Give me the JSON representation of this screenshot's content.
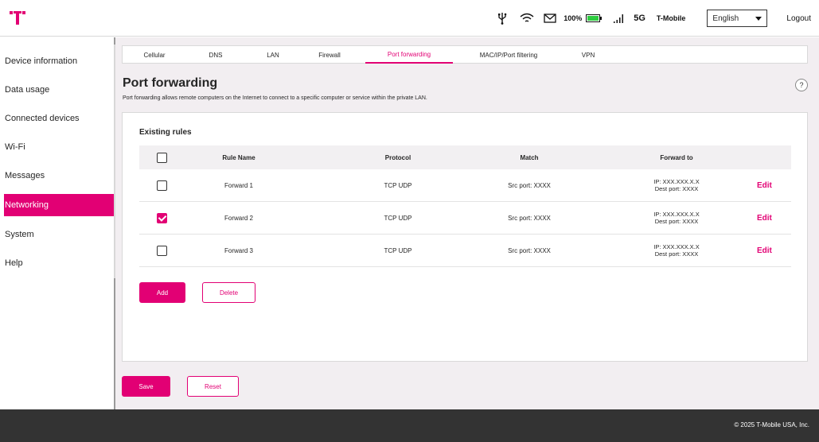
{
  "header": {
    "battery_percent": "100%",
    "network_type": "5G",
    "carrier": "T-Mobile",
    "language": "English",
    "logout_label": "Logout",
    "icons": [
      "t-mobile-logo",
      "usb-icon",
      "wifi-icon",
      "mail-icon",
      "battery-icon",
      "signal-icon",
      "chevron-down-icon"
    ]
  },
  "sidebar": {
    "items": [
      {
        "label": "Device information"
      },
      {
        "label": "Data usage"
      },
      {
        "label": "Connected devices"
      },
      {
        "label": "Wi-Fi"
      },
      {
        "label": "Messages"
      },
      {
        "label": "Networking",
        "active": true
      },
      {
        "label": "System"
      },
      {
        "label": "Help"
      }
    ]
  },
  "tabs": [
    {
      "label": "Cellular"
    },
    {
      "label": "DNS"
    },
    {
      "label": "LAN"
    },
    {
      "label": "Firewall"
    },
    {
      "label": "Port forwarding",
      "active": true
    },
    {
      "label": "MAC/IP/Port filtering"
    },
    {
      "label": "VPN"
    }
  ],
  "page": {
    "title": "Port forwarding",
    "description": "Port forwarding allows remote computers on the Internet to connect to a specific computer or service within the private LAN.",
    "help_label": "?"
  },
  "rules": {
    "title": "Existing rules",
    "headers": {
      "name": "Rule Name",
      "protocol": "Protocol",
      "match": "Match",
      "forward": "Forward to"
    },
    "rows": [
      {
        "name": "Forward 1",
        "protocol": "TCP UDP",
        "match": "Src port: XXXX",
        "ip": "IP: XXX.XXX.X.X",
        "dest": "Dest port: XXXX",
        "edit": "Edit",
        "checked": false
      },
      {
        "name": "Forward 2",
        "protocol": "TCP UDP",
        "match": "Src port: XXXX",
        "ip": "IP: XXX.XXX.X.X",
        "dest": "Dest port: XXXX",
        "edit": "Edit",
        "checked": true
      },
      {
        "name": "Forward 3",
        "protocol": "TCP UDP",
        "match": "Src port: XXXX",
        "ip": "IP: XXX.XXX.X.X",
        "dest": "Dest port: XXXX",
        "edit": "Edit",
        "checked": false
      }
    ],
    "add_label": "Add",
    "delete_label": "Delete"
  },
  "actions": {
    "save_label": "Save",
    "reset_label": "Reset"
  },
  "footer": {
    "copyright": "© 2025 T-Mobile USA, Inc."
  },
  "colors": {
    "brand": "#e20074",
    "footer": "#333333",
    "main_bg": "#f2eef1"
  }
}
